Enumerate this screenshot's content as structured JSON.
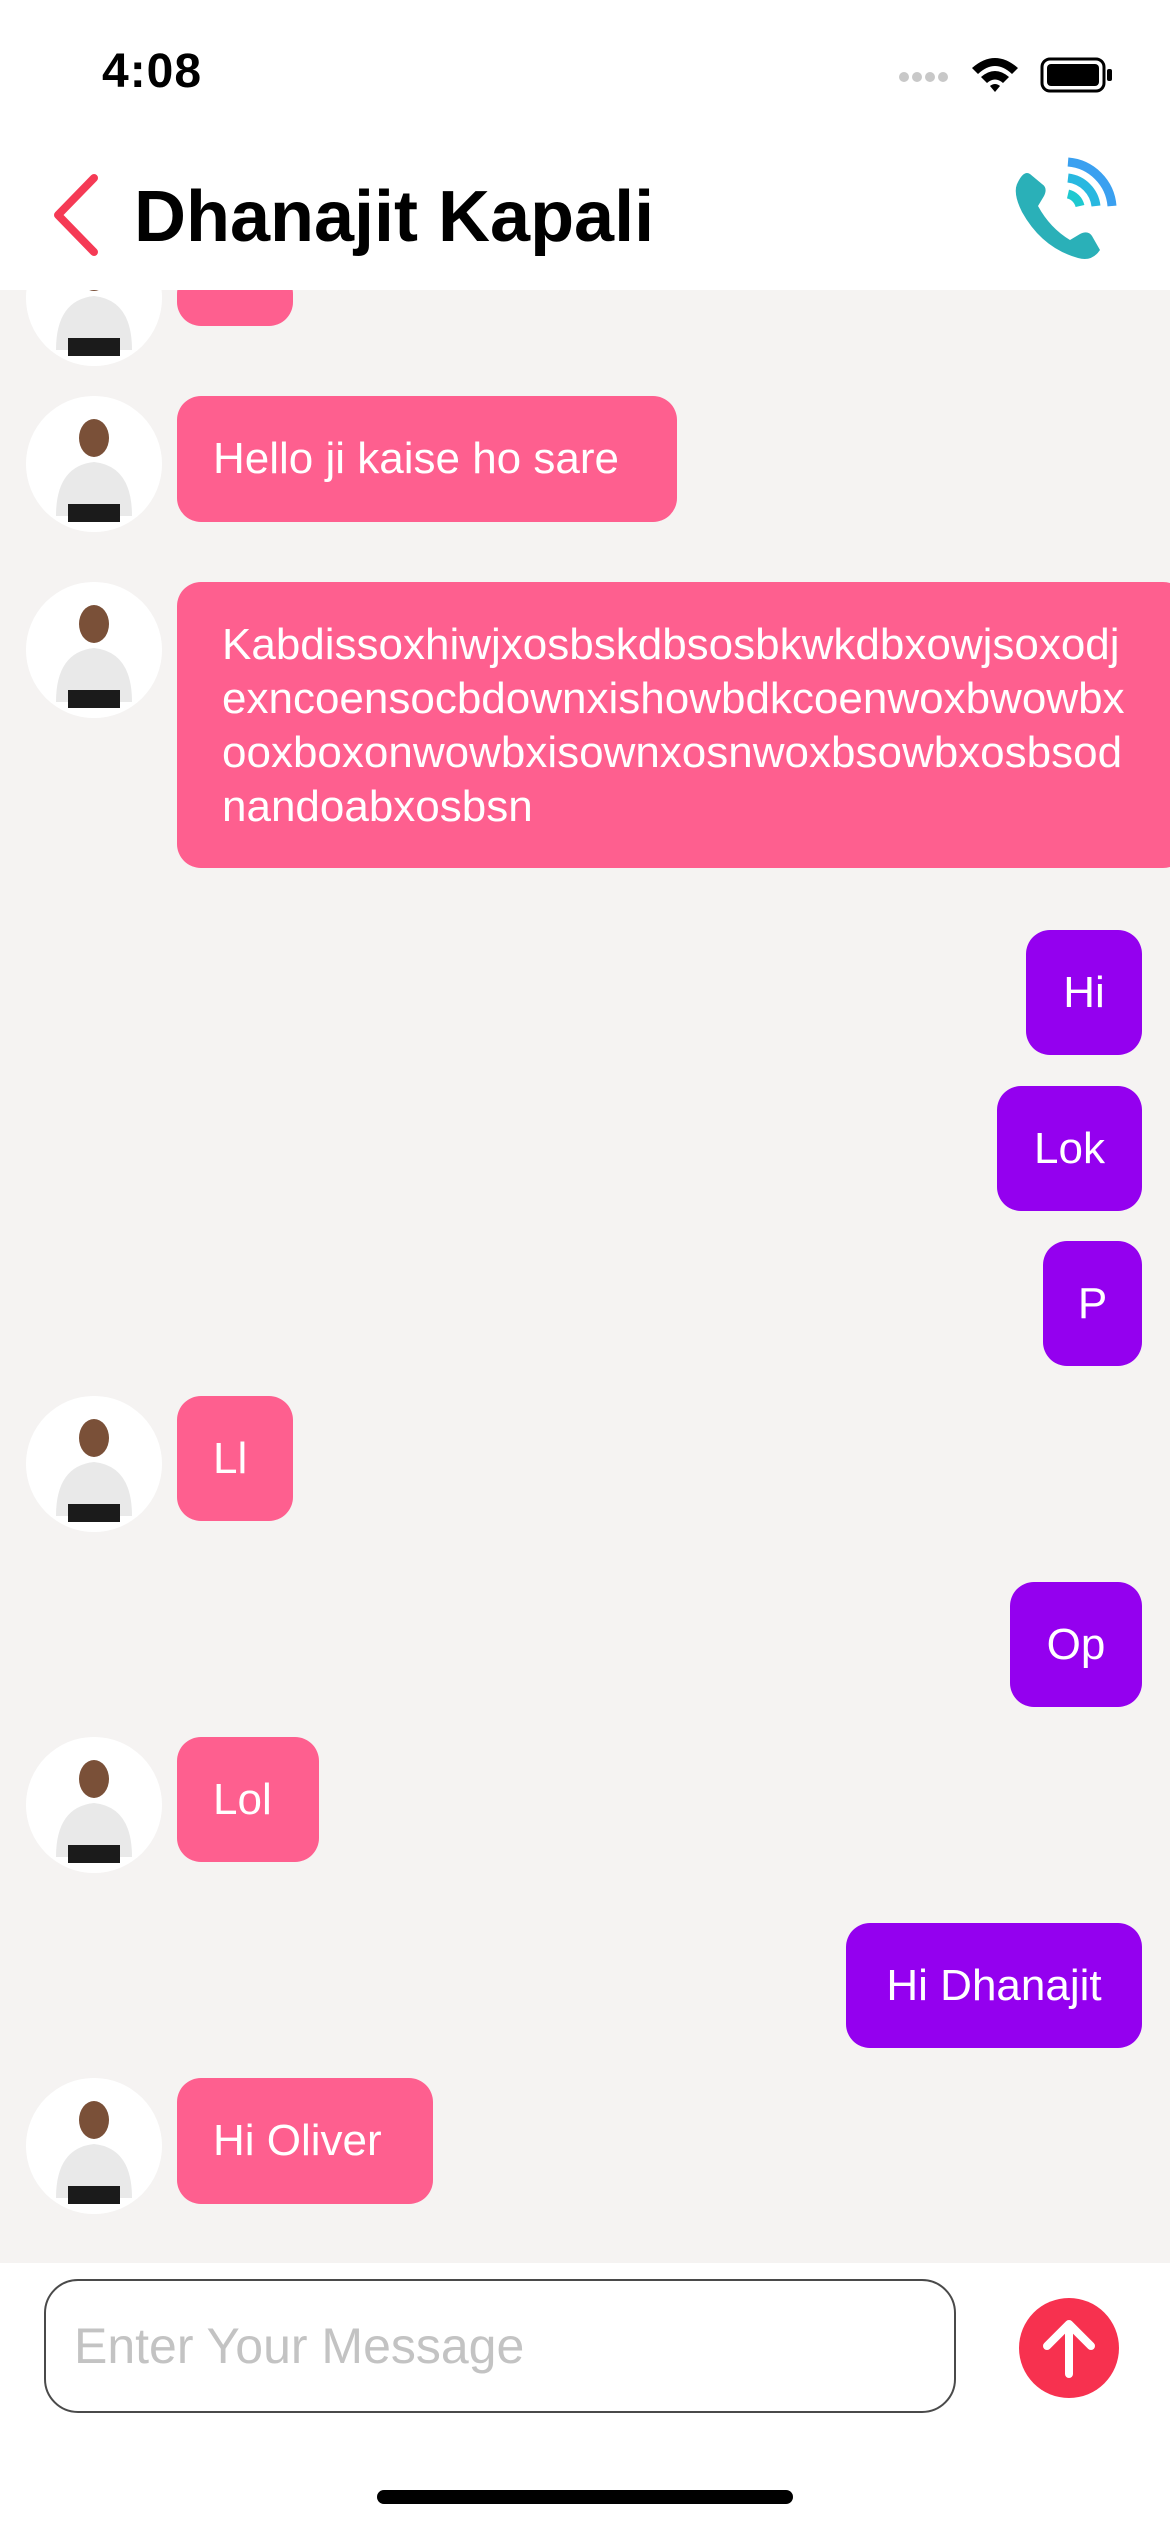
{
  "status_bar": {
    "time": "4:08"
  },
  "header": {
    "title": "Dhanajit Kapali"
  },
  "messages": [
    {
      "type": "in",
      "text": ""
    },
    {
      "type": "in",
      "text": "Hello ji kaise ho sare"
    },
    {
      "type": "in",
      "text": "Kabdissoxhiwjxosbskdbsosbkwkdbxowjsoxodjexncoensocbdownxishowbdkcoenwoxbwowbxooxboxonwowbxisownxosnwoxbsowbxosbsodnandoabxosbsn"
    },
    {
      "type": "out",
      "text": "Hi"
    },
    {
      "type": "out",
      "text": "Lok"
    },
    {
      "type": "out",
      "text": "P"
    },
    {
      "type": "in",
      "text": "Ll"
    },
    {
      "type": "out",
      "text": "Op"
    },
    {
      "type": "in",
      "text": "Lol"
    },
    {
      "type": "out",
      "text": "Hi Dhanajit"
    },
    {
      "type": "in",
      "text": "Hi Oliver"
    }
  ],
  "composer": {
    "placeholder": "Enter Your Message",
    "value": ""
  },
  "colors": {
    "incoming": "#fe5f8f",
    "outgoing": "#9400ef",
    "send": "#f7314f",
    "back": "#f53a55",
    "background": "#f5f3f2"
  },
  "icons": {
    "back": "chevron-left-icon",
    "call": "phone-call-icon",
    "send": "arrow-up-icon",
    "avatar": "contact-avatar"
  }
}
